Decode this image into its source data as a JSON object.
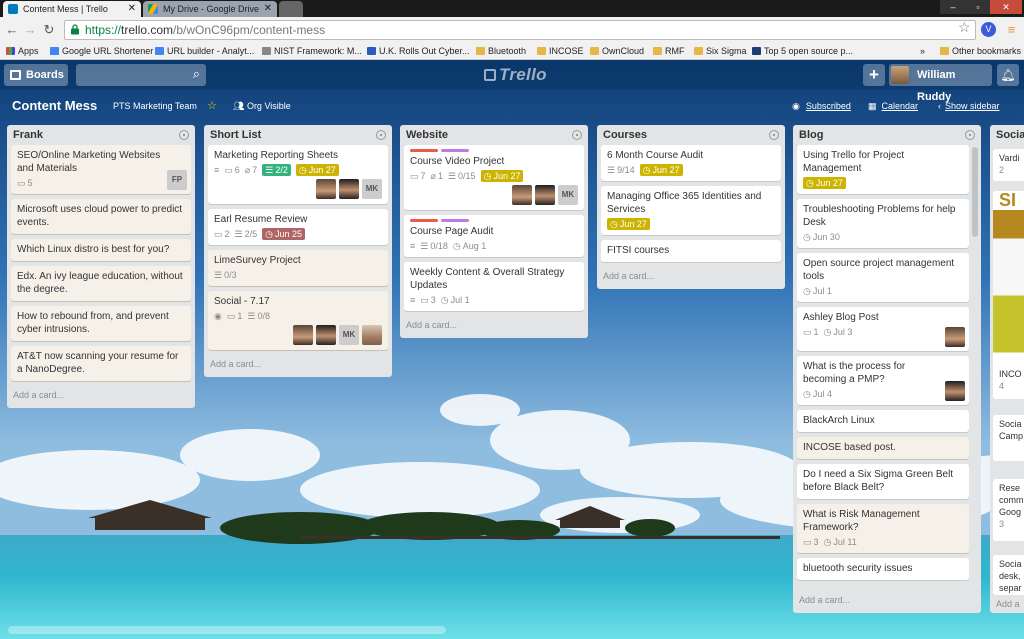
{
  "browser": {
    "tabs": [
      {
        "title": "Content Mess | Trello",
        "active": true
      },
      {
        "title": "My Drive - Google Drive",
        "active": false
      }
    ],
    "url": {
      "scheme": "https://",
      "host": "trello.com",
      "path": "/b/wOnC96pm/content-mess"
    },
    "bookmarks": [
      {
        "label": "Apps",
        "icon": "apps-grid-icon"
      },
      {
        "label": "Google URL Shortener",
        "icon": "google-icon"
      },
      {
        "label": "URL builder - Analyt...",
        "icon": "google-icon"
      },
      {
        "label": "NIST Framework: M...",
        "icon": "page-icon"
      },
      {
        "label": "U.K. Rolls Out Cyber...",
        "icon": "page-icon"
      },
      {
        "label": "Bluetooth",
        "icon": "folder-icon"
      },
      {
        "label": "INCOSE",
        "icon": "folder-icon"
      },
      {
        "label": "OwnCloud",
        "icon": "folder-icon"
      },
      {
        "label": "RMF",
        "icon": "folder-icon"
      },
      {
        "label": "Six Sigma",
        "icon": "folder-icon"
      },
      {
        "label": "Top 5 open source p...",
        "icon": "page-icon"
      }
    ],
    "more_bookmarks": "»",
    "other_bookmarks": "Other bookmarks"
  },
  "header": {
    "boards_label": "Boards",
    "logo": "Trello",
    "user_name": "William Ruddy",
    "add_label": "+"
  },
  "board": {
    "title": "Content Mess",
    "team": "PTS Marketing Team",
    "visibility": "Org Visible",
    "subscribed": "Subscribed",
    "calendar": "Calendar",
    "show_sidebar": "Show sidebar"
  },
  "add_card_label": "Add a card...",
  "lists": [
    {
      "name": "Frank",
      "cards": [
        {
          "title": "SEO/Online Marketing Websites and Materials",
          "aged": true,
          "comments": "5",
          "members": [
            {
              "type": "initials",
              "text": "FP"
            }
          ],
          "float_members": true
        },
        {
          "title": "Microsoft uses cloud power to predict events.",
          "aged": true
        },
        {
          "title": "Which Linux distro is best for you?",
          "aged": true
        },
        {
          "title": "Edx. An ivy league education, without the degree.",
          "aged": true
        },
        {
          "title": "How to rebound from, and prevent cyber intrusions.",
          "aged": true
        },
        {
          "title": "AT&T now scanning your resume for a NanoDegree.",
          "aged": true
        }
      ]
    },
    {
      "name": "Short List",
      "cards": [
        {
          "title": "Marketing Reporting Sheets",
          "description": true,
          "comments": "6",
          "attachments": "7",
          "checklist_done": "2/2",
          "due": "Jun 27",
          "members": [
            {
              "type": "photo1"
            },
            {
              "type": "photo2"
            },
            {
              "type": "initials",
              "text": "MK"
            }
          ]
        },
        {
          "title": "Earl Resume Review",
          "comments": "2",
          "checklist": "2/5",
          "due_past": "Jun 25"
        },
        {
          "title": "LimeSurvey Project",
          "aged": true,
          "checklist": "0/3"
        },
        {
          "title": "Social - 7.17",
          "aged": true,
          "watching": true,
          "comments": "1",
          "checklist": "0/8",
          "members": [
            {
              "type": "photo1"
            },
            {
              "type": "photo2"
            },
            {
              "type": "initials",
              "text": "MK"
            },
            {
              "type": "photo3"
            }
          ]
        }
      ]
    },
    {
      "name": "Website",
      "cards": [
        {
          "title": "Course Video Project",
          "labels": [
            "#eb5a46",
            "#c377e0"
          ],
          "comments": "7",
          "attachments": "1",
          "checklist": "0/15",
          "due": "Jun 27",
          "members": [
            {
              "type": "photo1"
            },
            {
              "type": "photo2"
            },
            {
              "type": "initials",
              "text": "MK"
            }
          ]
        },
        {
          "title": "Course Page Audit",
          "labels": [
            "#eb5a46",
            "#c377e0"
          ],
          "description": true,
          "checklist": "0/18",
          "date": "Aug 1"
        },
        {
          "title": "Weekly Content & Overall Strategy Updates",
          "description": true,
          "comments": "3",
          "date": "Jul 1"
        }
      ]
    },
    {
      "name": "Courses",
      "cards": [
        {
          "title": "6 Month Course Audit",
          "checklist": "9/14",
          "due": "Jun 27"
        },
        {
          "title": "Managing Office 365 Identities and Services",
          "due": "Jun 27"
        },
        {
          "title": "FITSI courses"
        }
      ]
    },
    {
      "name": "Blog",
      "cards": [
        {
          "title": "Using Trello for Project Management",
          "due": "Jun 27"
        },
        {
          "title": "Troubleshooting Problems for help Desk",
          "date": "Jun 30"
        },
        {
          "title": "Open source project management tools",
          "date": "Jul 1"
        },
        {
          "title": "Ashley Blog Post",
          "comments": "1",
          "date": "Jul 3",
          "members": [
            {
              "type": "photo1"
            }
          ],
          "float_members": true
        },
        {
          "title": "What is the process for becoming a PMP?",
          "date": "Jul 4",
          "members": [
            {
              "type": "photo2"
            }
          ],
          "float_members": true
        },
        {
          "title": "BlackArch Linux"
        },
        {
          "title": "INCOSE based post.",
          "aged": true
        },
        {
          "title": "Do I need a Six Sigma Green Belt before Black Belt?"
        },
        {
          "title": "What is Risk Management Framework?",
          "aged": true,
          "comments": "3",
          "date": "Jul 11"
        },
        {
          "title": "bluetooth security issues"
        }
      ]
    }
  ],
  "partial_list": {
    "name": "Socia",
    "cards": [
      {
        "text": "Vardi"
      },
      {
        "text": "2"
      },
      {
        "text": "SI"
      },
      {
        "text": "INCO"
      },
      {
        "text": "4"
      },
      {
        "text": "Socia"
      },
      {
        "text": "Camp"
      },
      {
        "text": "Rese"
      },
      {
        "text": "comm"
      },
      {
        "text": "Goog"
      },
      {
        "text": "3"
      },
      {
        "text": "Socia"
      },
      {
        "text": "desk,"
      },
      {
        "text": "separ"
      },
      {
        "text": "Add a"
      }
    ]
  }
}
